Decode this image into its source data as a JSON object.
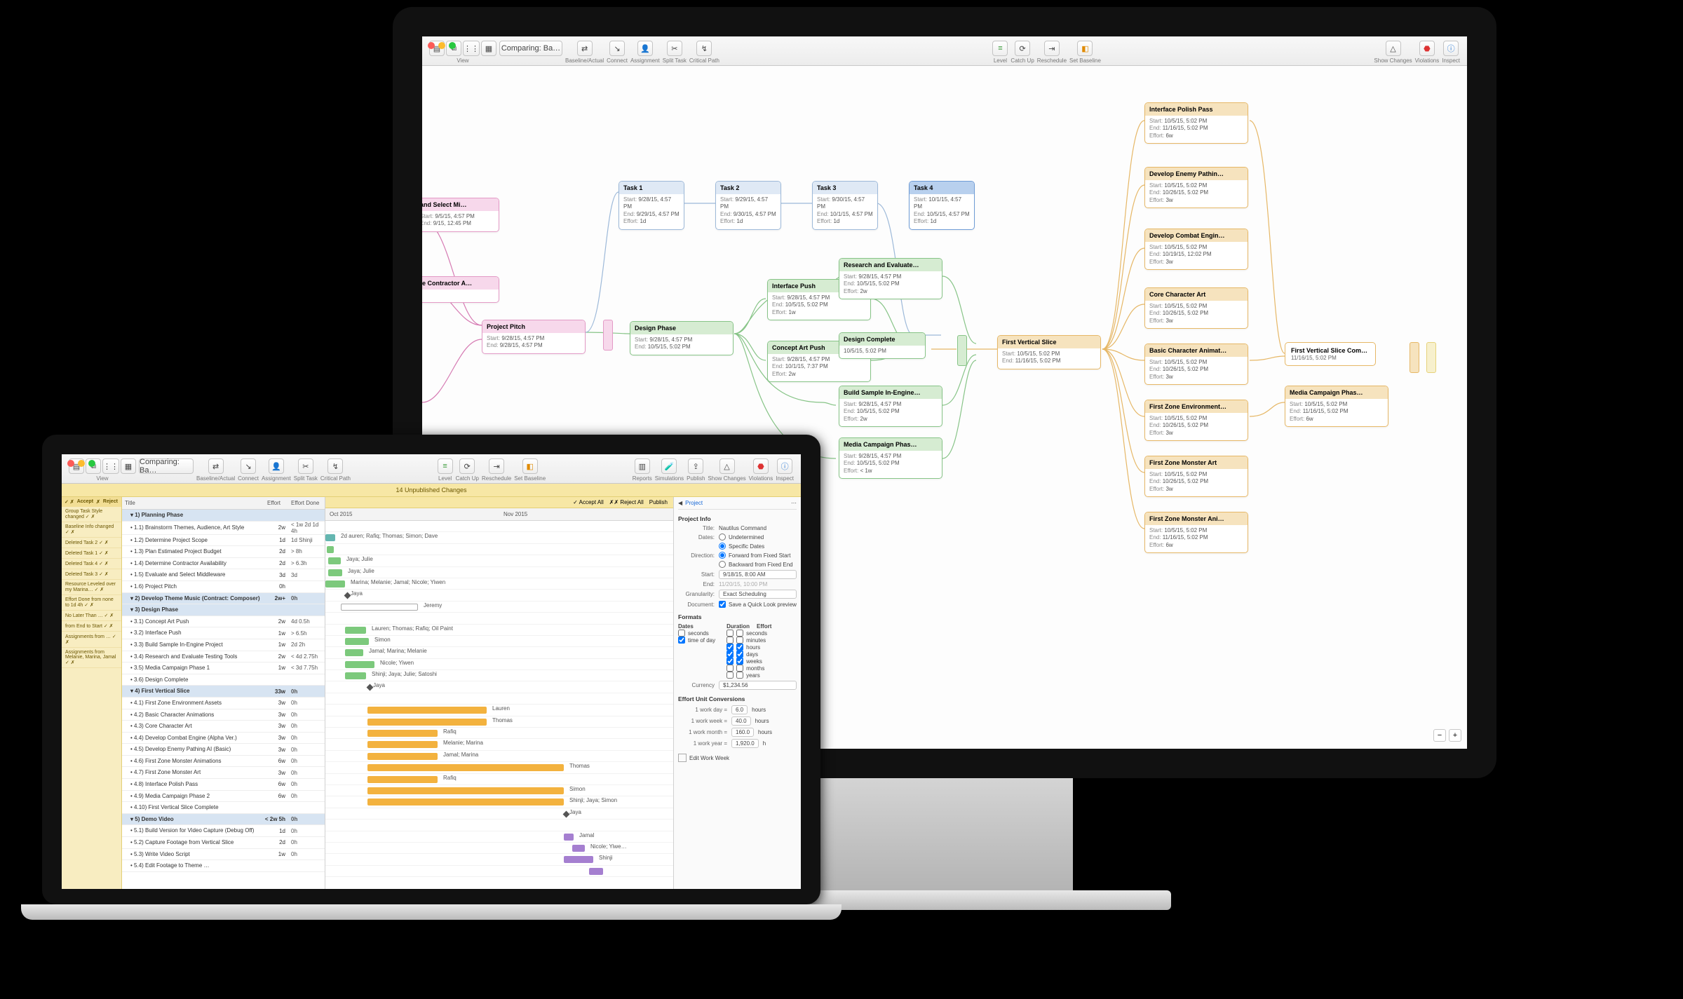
{
  "imac": {
    "toolbar": {
      "view": "View",
      "baseline": "Baseline/Actual",
      "connect": "Connect",
      "assignment": "Assignment",
      "splittask": "Split Task",
      "critical": "Critical Path",
      "level": "Level",
      "catchup": "Catch Up",
      "reschedule": "Reschedule",
      "setbaseline": "Set Baseline",
      "showchanges": "Show Changes",
      "violations": "Violations",
      "inspect": "Inspect",
      "doc": "Comparing: Ba…"
    },
    "nodes": {
      "selectmi": {
        "title": "and Select Mi…",
        "start": "9/5/15, 4:57 PM",
        "end": "9/15, 12:45 PM",
        "effort": ""
      },
      "contractor": {
        "title": "te Contractor A…",
        "start": "",
        "end": "",
        "effort": ""
      },
      "pitch": {
        "title": "Project Pitch",
        "start": "9/28/15, 4:57 PM",
        "end": "9/28/15, 4:57 PM"
      },
      "task1": {
        "title": "Task 1",
        "start": "9/28/15, 4:57 PM",
        "end": "9/29/15, 4:57 PM",
        "effort": "1d"
      },
      "task2": {
        "title": "Task 2",
        "start": "9/29/15, 4:57 PM",
        "end": "9/30/15, 4:57 PM",
        "effort": "1d"
      },
      "task3": {
        "title": "Task 3",
        "start": "9/30/15, 4:57 PM",
        "end": "10/1/15, 4:57 PM",
        "effort": "1d"
      },
      "task4": {
        "title": "Task 4",
        "start": "10/1/15, 4:57 PM",
        "end": "10/5/15, 4:57 PM",
        "effort": "1d"
      },
      "design": {
        "title": "Design Phase",
        "start": "9/28/15, 4:57 PM",
        "end": "10/5/15, 5:02 PM"
      },
      "ifpush": {
        "title": "Interface Push",
        "start": "9/28/15, 4:57 PM",
        "end": "10/5/15, 5:02 PM",
        "effort": "1w"
      },
      "concept": {
        "title": "Concept Art Push",
        "start": "9/28/15, 4:57 PM",
        "end": "10/1/15, 7:37 PM",
        "effort": "2w"
      },
      "research": {
        "title": "Research and Evaluate…",
        "start": "9/28/15, 4:57 PM",
        "end": "10/5/15, 5:02 PM",
        "effort": "2w"
      },
      "designdone": {
        "title": "Design Complete",
        "date": "10/5/15, 5:02 PM"
      },
      "sample": {
        "title": "Build Sample In-Engine…",
        "start": "9/28/15, 4:57 PM",
        "end": "10/5/15, 5:02 PM",
        "effort": "2w"
      },
      "mediaphase": {
        "title": "Media Campaign Phas…",
        "start": "9/28/15, 4:57 PM",
        "end": "10/5/15, 5:02 PM",
        "effort": "< 1w"
      },
      "fvs": {
        "title": "First Vertical Slice",
        "start": "10/5/15, 5:02 PM",
        "end": "11/16/15, 5:02 PM"
      },
      "polish": {
        "title": "Interface Polish Pass",
        "start": "10/5/15, 5:02 PM",
        "end": "11/16/15, 5:02 PM",
        "effort": "6w"
      },
      "enemy": {
        "title": "Develop Enemy Pathin…",
        "start": "10/5/15, 5:02 PM",
        "end": "10/26/15, 5:02 PM",
        "effort": "3w"
      },
      "combat": {
        "title": "Develop Combat Engin…",
        "start": "10/5/15, 5:02 PM",
        "end": "10/19/15, 12:02 PM",
        "effort": "3w"
      },
      "coreart": {
        "title": "Core Character Art",
        "start": "10/5/15, 5:02 PM",
        "end": "10/26/15, 5:02 PM",
        "effort": "3w"
      },
      "anim": {
        "title": "Basic Character Animat…",
        "start": "10/5/15, 5:02 PM",
        "end": "10/26/15, 5:02 PM",
        "effort": "3w"
      },
      "zoneenv": {
        "title": "First Zone Environment…",
        "start": "10/5/15, 5:02 PM",
        "end": "10/26/15, 5:02 PM",
        "effort": "3w"
      },
      "zonemon": {
        "title": "First Zone Monster Art",
        "start": "10/5/15, 5:02 PM",
        "end": "10/26/15, 5:02 PM",
        "effort": "3w"
      },
      "zoneani": {
        "title": "First Zone Monster Ani…",
        "start": "10/5/15, 5:02 PM",
        "end": "11/16/15, 5:02 PM",
        "effort": "6w"
      },
      "fvsdone": {
        "title": "First Vertical Slice Com…",
        "date": "11/16/15, 5:02 PM"
      },
      "media2": {
        "title": "Media Campaign Phas…",
        "start": "10/5/15, 5:02 PM",
        "end": "11/16/15, 5:02 PM",
        "effort": "6w"
      }
    }
  },
  "mb": {
    "toolbar": {
      "view": "View",
      "baseline": "Baseline/Actual",
      "connect": "Connect",
      "assignment": "Assignment",
      "splittask": "Split Task",
      "critical": "Critical Path",
      "level": "Level",
      "catchup": "Catch Up",
      "reschedule": "Reschedule",
      "setbaseline": "Set Baseline",
      "reports": "Reports",
      "simulations": "Simulations",
      "publish": "Publish",
      "showchanges": "Show Changes",
      "violations": "Violations",
      "inspect": "Inspect",
      "doc": "Comparing: Ba…"
    },
    "banner": "14 Unpublished Changes",
    "changes_hdr": {
      "accept": "Accept",
      "reject": "Reject"
    },
    "changes": [
      "Group Task Style changed",
      "Baseline Info changed",
      "Deleted Task 2",
      "Deleted Task 1",
      "Deleted Task 4",
      "Deleted Task 3",
      "Resource Leveled over my Marina…",
      "Effort Done from none to 1d 4h",
      "No Later Than …",
      "from End to Start",
      "Assignments from …",
      "Assignments from Melanie, Marina, Jamal"
    ],
    "topbar": {
      "acceptall": "Accept All",
      "rejectall": "Reject All",
      "publish": "Publish"
    },
    "columns": {
      "title": "Title",
      "effort": "Effort",
      "effortdone": "Effort Done"
    },
    "months": [
      "Oct 2015",
      "Nov 2015"
    ],
    "rows": [
      {
        "grp": true,
        "num": "1)",
        "title": "Planning Phase",
        "effort": "",
        "done": ""
      },
      {
        "num": "1.1)",
        "title": "Brainstorm Themes, Audience, Art Style",
        "effort": "2w",
        "done": "< 1w 2d 1d 4h",
        "res": "2d auren; Rafiq; Thomas; Simon; Dave"
      },
      {
        "num": "1.2)",
        "title": "Determine Project Scope",
        "effort": "1d",
        "done": "1d Shinji"
      },
      {
        "num": "1.3)",
        "title": "Plan Estimated Project Budget",
        "effort": "2d",
        "done": "> 8h",
        "res": "Jaya; Julie"
      },
      {
        "num": "1.4)",
        "title": "Determine Contractor Availability",
        "effort": "2d",
        "done": "> 6.3h",
        "res": "Jaya; Julie"
      },
      {
        "num": "1.5)",
        "title": "Evaluate and Select Middleware",
        "effort": "3d",
        "done": "3d",
        "res": "Marina; Melanie; Jamal; Nicole; Yiwen"
      },
      {
        "num": "1.6)",
        "title": "Project Pitch",
        "effort": "0h",
        "done": "",
        "res": "Jaya"
      },
      {
        "grp": true,
        "num": "2)",
        "title": "Develop Theme Music (Contract: Composer)",
        "effort": "2w+",
        "done": "0h",
        "res": "Jeremy"
      },
      {
        "grp": true,
        "num": "3)",
        "title": "Design Phase",
        "effort": "",
        "done": ""
      },
      {
        "num": "3.1)",
        "title": "Concept Art Push",
        "effort": "2w",
        "done": "4d 0.5h",
        "res": "Lauren; Thomas; Rafiq; Oil Paint"
      },
      {
        "num": "3.2)",
        "title": "Interface Push",
        "effort": "1w",
        "done": "> 6.5h",
        "res": "Simon"
      },
      {
        "num": "3.3)",
        "title": "Build Sample In-Engine Project",
        "effort": "1w",
        "done": "2d 2h",
        "res": "Jamal; Marina; Melanie"
      },
      {
        "num": "3.4)",
        "title": "Research and Evaluate Testing Tools",
        "effort": "2w",
        "done": "< 4d 2.75h",
        "res": "Nicole; Yiwen"
      },
      {
        "num": "3.5)",
        "title": "Media Campaign Phase 1",
        "effort": "1w",
        "done": "< 3d 7.75h",
        "res": "Shinji; Jaya; Julie; Satoshi"
      },
      {
        "num": "3.6)",
        "title": "Design Complete",
        "effort": "",
        "done": "",
        "res": "Jaya"
      },
      {
        "grp": true,
        "num": "4)",
        "title": "First Vertical Slice",
        "effort": "33w",
        "done": "0h"
      },
      {
        "num": "4.1)",
        "title": "First Zone Environment Assets",
        "effort": "3w",
        "done": "0h",
        "res": "Lauren"
      },
      {
        "num": "4.2)",
        "title": "Basic Character Animations",
        "effort": "3w",
        "done": "0h",
        "res": "Thomas"
      },
      {
        "num": "4.3)",
        "title": "Core Character Art",
        "effort": "3w",
        "done": "0h",
        "res": "Rafiq"
      },
      {
        "num": "4.4)",
        "title": "Develop Combat Engine (Alpha Ver.)",
        "effort": "3w",
        "done": "0h",
        "res": "Melanie; Marina"
      },
      {
        "num": "4.5)",
        "title": "Develop Enemy Pathing AI (Basic)",
        "effort": "3w",
        "done": "0h",
        "res": "Jamal; Marina"
      },
      {
        "num": "4.6)",
        "title": "First Zone Monster Animations",
        "effort": "6w",
        "done": "0h",
        "res": "Thomas"
      },
      {
        "num": "4.7)",
        "title": "First Zone Monster Art",
        "effort": "3w",
        "done": "0h",
        "res": "Rafiq"
      },
      {
        "num": "4.8)",
        "title": "Interface Polish Pass",
        "effort": "6w",
        "done": "0h",
        "res": "Simon"
      },
      {
        "num": "4.9)",
        "title": "Media Campaign Phase 2",
        "effort": "6w",
        "done": "0h",
        "res": "Shinji; Jaya; Simon"
      },
      {
        "num": "4.10)",
        "title": "First Vertical Slice Complete",
        "effort": "",
        "done": "",
        "res": "Jaya"
      },
      {
        "grp": true,
        "num": "5)",
        "title": "Demo Video",
        "effort": "< 2w 5h",
        "done": "0h"
      },
      {
        "num": "5.1)",
        "title": "Build Version for Video Capture (Debug Off)",
        "effort": "1d",
        "done": "0h",
        "res": "Jamal"
      },
      {
        "num": "5.2)",
        "title": "Capture Footage from Vertical Slice",
        "effort": "2d",
        "done": "0h",
        "res": "Nicole; Yiwe…"
      },
      {
        "num": "5.3)",
        "title": "Write Video Script",
        "effort": "1w",
        "done": "0h",
        "res": "Shinji"
      },
      {
        "num": "5.4)",
        "title": "Edit Footage to Theme …",
        "effort": "",
        "done": ""
      }
    ],
    "inspector": {
      "project_info": "Project Info",
      "title_lbl": "Title:",
      "title": "Nautilus Command",
      "dates_lbl": "Dates:",
      "dates_opt1": "Undetermined",
      "dates_opt2": "Specific Dates",
      "dir_lbl": "Direction:",
      "dir_opt1": "Forward from Fixed Start",
      "dir_opt2": "Backward from Fixed End",
      "start_lbl": "Start:",
      "start": "9/18/15, 8:00 AM",
      "end_lbl": "End:",
      "end": "11/20/15, 10:00 PM",
      "gran_lbl": "Granularity:",
      "gran": "Exact Scheduling",
      "doc_lbl": "Document:",
      "doc": "Save a Quick Look preview",
      "formats": "Formats",
      "dates": "Dates",
      "duration": "Duration",
      "effort": "Effort",
      "opt_seconds": "seconds",
      "opt_timeofday": "time of day",
      "u_seconds": "seconds",
      "u_minutes": "minutes",
      "u_hours": "hours",
      "u_days": "days",
      "u_weeks": "weeks",
      "u_months": "months",
      "u_years": "years",
      "currency_lbl": "Currency",
      "currency": "$1,234.56",
      "euc": "Effort Unit Conversions",
      "workday": "1 work day =",
      "workday_v": "6.0",
      "workday_u": "hours",
      "workweek": "1 work week =",
      "workweek_v": "40.0",
      "workweek_u": "hours",
      "workmonth": "1 work month =",
      "workmonth_v": "160.0",
      "workmonth_u": "hours",
      "workyear": "1 work year =",
      "workyear_v": "1,920.0",
      "workyear_u": "h",
      "editww": "Edit Work Week"
    }
  }
}
